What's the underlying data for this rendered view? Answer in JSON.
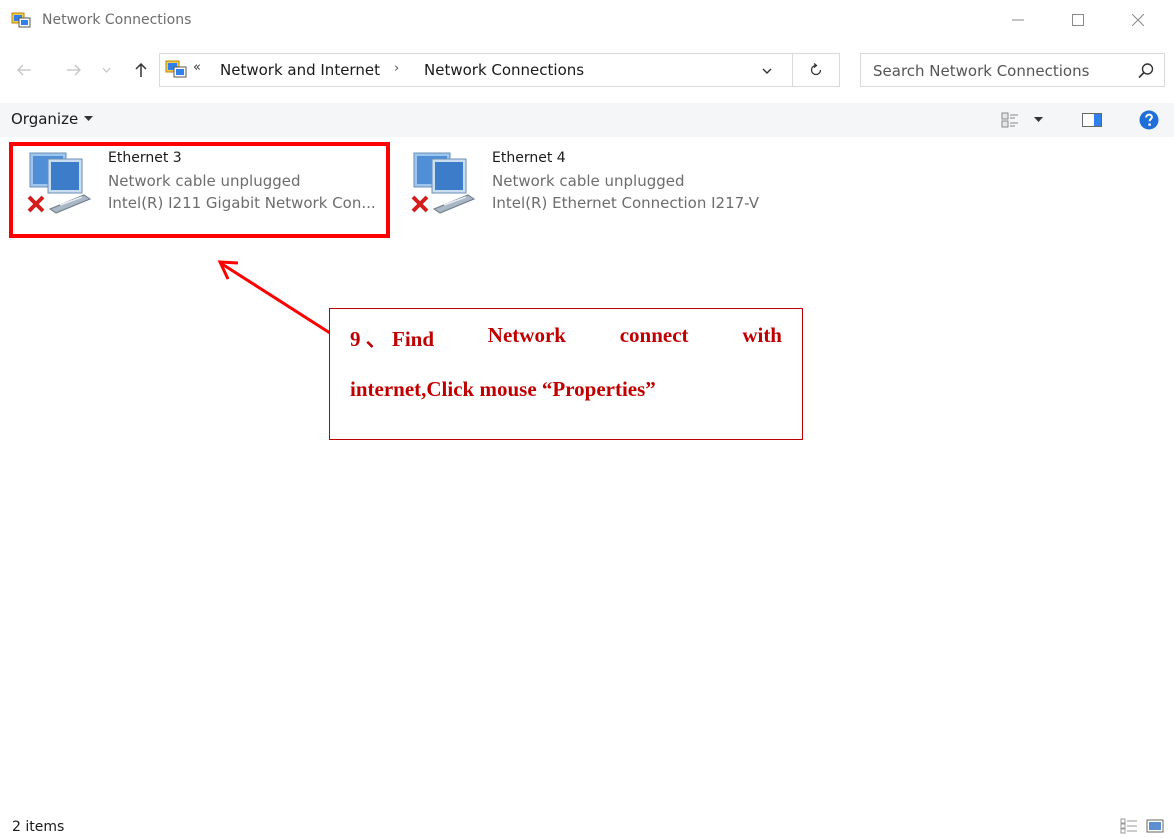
{
  "window": {
    "title": "Network Connections"
  },
  "address_bar": {
    "overflow_chevron": "«",
    "breadcrumbs": [
      "Network and Internet",
      "Network Connections"
    ],
    "separator": "›"
  },
  "search": {
    "placeholder": "Search Network Connections"
  },
  "toolbar": {
    "organize_label": "Organize"
  },
  "items": [
    {
      "name": "Ethernet 3",
      "status": "Network cable unplugged",
      "device": "Intel(R) I211 Gigabit Network Con..."
    },
    {
      "name": "Ethernet 4",
      "status": "Network cable unplugged",
      "device": "Intel(R) Ethernet Connection I217-V"
    }
  ],
  "annotation": {
    "line1_parts": [
      "9 、 Find",
      "Network",
      "connect",
      "with"
    ],
    "line2": "internet,Click mouse “Properties”",
    "color": "#c00000",
    "box_color": "#ff0000"
  },
  "status_bar": {
    "item_count": "2 items"
  },
  "colors": {
    "accent": "#0078d7",
    "command_bar_bg": "#f5f6f7",
    "muted_text": "#6d6d6d"
  }
}
